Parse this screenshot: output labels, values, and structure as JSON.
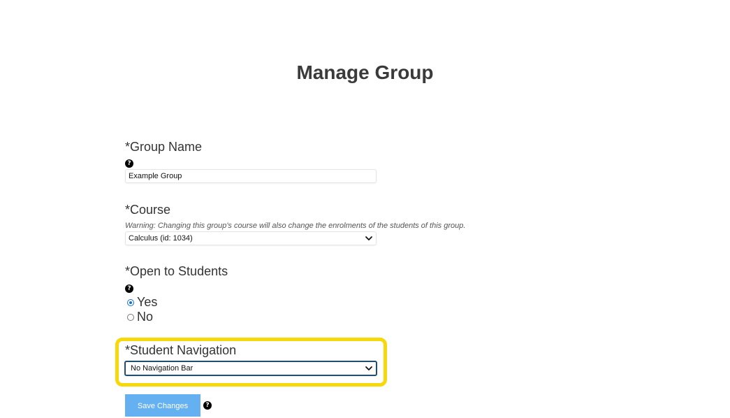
{
  "page": {
    "title": "Manage Group"
  },
  "form": {
    "group_name": {
      "label": "*Group Name",
      "value": "Example Group",
      "help_icon": "question-circle-icon"
    },
    "course": {
      "label": "*Course",
      "warning": "Warning: Changing this group's course will also change the enrolments of the students of this group.",
      "selected": "Calculus (id: 1034)"
    },
    "open_to_students": {
      "label": "*Open to Students",
      "help_icon": "question-circle-icon",
      "options": [
        {
          "label": "Yes",
          "checked": true
        },
        {
          "label": "No",
          "checked": false
        }
      ]
    },
    "student_navigation": {
      "label": "*Student Navigation",
      "selected": "No Navigation Bar",
      "highlight_color": "#f7d80a"
    },
    "save_button": {
      "label": "Save Changes",
      "color": "#64b0f0",
      "help_icon": "question-circle-icon"
    }
  }
}
